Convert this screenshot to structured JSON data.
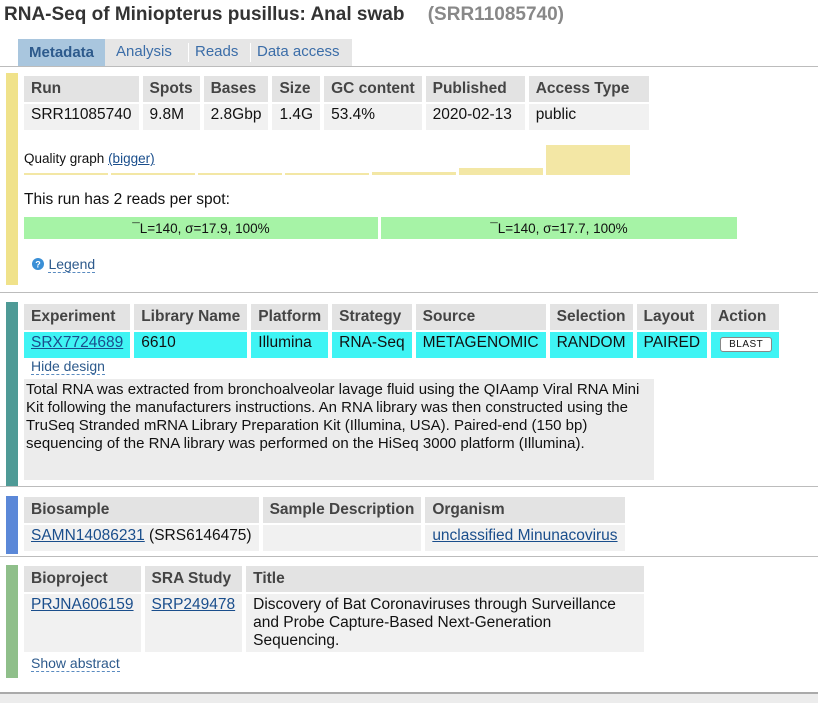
{
  "page": {
    "title": "RNA-Seq of Miniopterus pusillus: Anal swab",
    "accession": "(SRR11085740)"
  },
  "tabs": [
    {
      "label": "Metadata",
      "active": true
    },
    {
      "label": "Analysis",
      "active": false
    },
    {
      "label": "Reads",
      "active": false
    },
    {
      "label": "Data access",
      "active": false
    }
  ],
  "run_panel": {
    "headers": [
      "Run",
      "Spots",
      "Bases",
      "Size",
      "GC content",
      "Published",
      "Access Type"
    ],
    "row": [
      "SRR11085740",
      "9.8M",
      "2.8Gbp",
      "1.4G",
      "53.4%",
      "2020-02-13",
      "public"
    ],
    "quality_label": "Quality graph",
    "quality_link": "(bigger)",
    "quality_levels": [
      0.04,
      0.04,
      0.06,
      0.06,
      0.1,
      0.22,
      1.0
    ],
    "reads_text": "This run has 2 reads per spot:",
    "reads": [
      "¯L=140, σ=17.9, 100%",
      "¯L=140, σ=17.7, 100%"
    ],
    "legend_icon": "help-icon",
    "legend_label": "Legend",
    "bar_color": "#f0e28a"
  },
  "experiment_panel": {
    "headers": [
      "Experiment",
      "Library Name",
      "Platform",
      "Strategy",
      "Source",
      "Selection",
      "Layout",
      "Action"
    ],
    "row": [
      "SRX7724689",
      "6610",
      "Illumina",
      "RNA-Seq",
      "METAGENOMIC",
      "RANDOM",
      "PAIRED"
    ],
    "action_button": "BLAST",
    "hide_design": "Hide design",
    "description": "Total RNA was extracted from bronchoalveolar lavage fluid using the QIAamp Viral RNA Mini Kit following the manufacturers instructions. An RNA library was then constructed using the TruSeq Stranded mRNA Library Preparation Kit (Illumina, USA). Paired-end (150 bp) sequencing of the RNA library was performed on the HiSeq 3000 platform (Illumina).",
    "bar_color": "#4e9a96",
    "highlight_color": "#3ff4f4"
  },
  "biosample_panel": {
    "headers": [
      "Biosample",
      "Sample Description",
      "Organism"
    ],
    "biosample_link": "SAMN14086231",
    "biosample_extra": " (SRS6146475)",
    "sample_description": "",
    "organism_link": "unclassified Minunacovirus",
    "bar_color": "#5b88d8"
  },
  "bioproject_panel": {
    "headers": [
      "Bioproject",
      "SRA Study",
      "Title"
    ],
    "bioproject_link": "PRJNA606159",
    "study_link": "SRP249478",
    "title_lines": [
      "Discovery of Bat Coronaviruses through Surveillance",
      "and Probe Capture-Based Next-Generation",
      "Sequencing."
    ],
    "show_abstract": "Show abstract",
    "bar_color": "#8fbf8a"
  }
}
